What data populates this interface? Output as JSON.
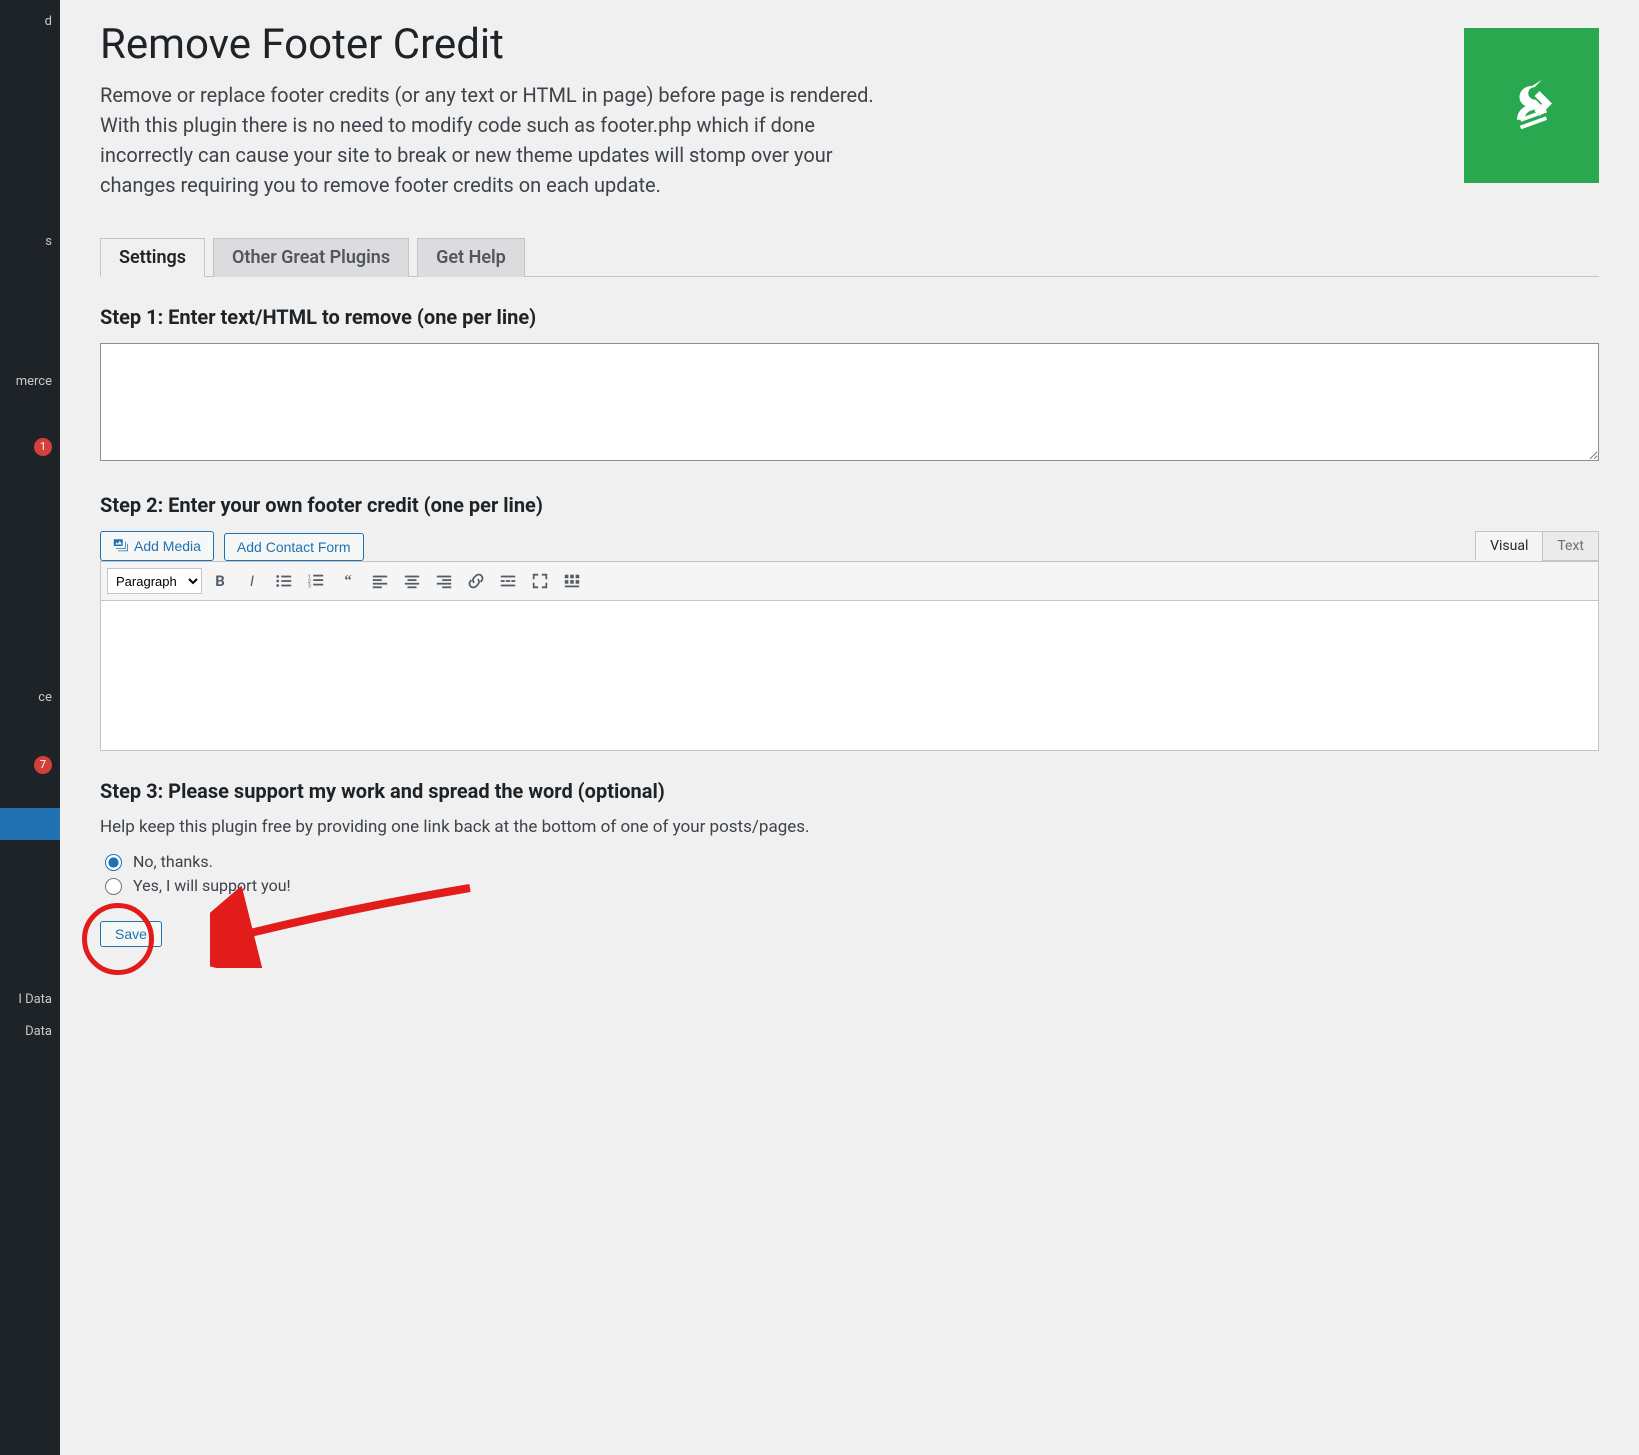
{
  "sidebar": {
    "fragments": [
      "d",
      "s",
      "merce",
      "ce",
      "I Data",
      "Data"
    ],
    "badges": [
      "1",
      "7"
    ]
  },
  "header": {
    "title": "Remove Footer Credit",
    "description": "Remove or replace footer credits (or any text or HTML in page) before page is rendered. With this plugin there is no need to modify code such as footer.php which if done incorrectly can cause your site to break or new theme updates will stomp over your changes requiring you to remove footer credits on each update."
  },
  "tabs": [
    "Settings",
    "Other Great Plugins",
    "Get Help"
  ],
  "step1": {
    "label": "Step 1: Enter text/HTML to remove (one per line)",
    "value": ""
  },
  "step2": {
    "label": "Step 2: Enter your own footer credit (one per line)",
    "add_media": "Add Media",
    "add_contact": "Add Contact Form",
    "tab_visual": "Visual",
    "tab_text": "Text",
    "paragraph_selected": "Paragraph"
  },
  "step3": {
    "label": "Step 3: Please support my work and spread the word (optional)",
    "help": "Help keep this plugin free by providing one link back at the bottom of one of your posts/pages.",
    "option_no": "No, thanks.",
    "option_yes": "Yes, I will support you!"
  },
  "actions": {
    "save": "Save"
  }
}
